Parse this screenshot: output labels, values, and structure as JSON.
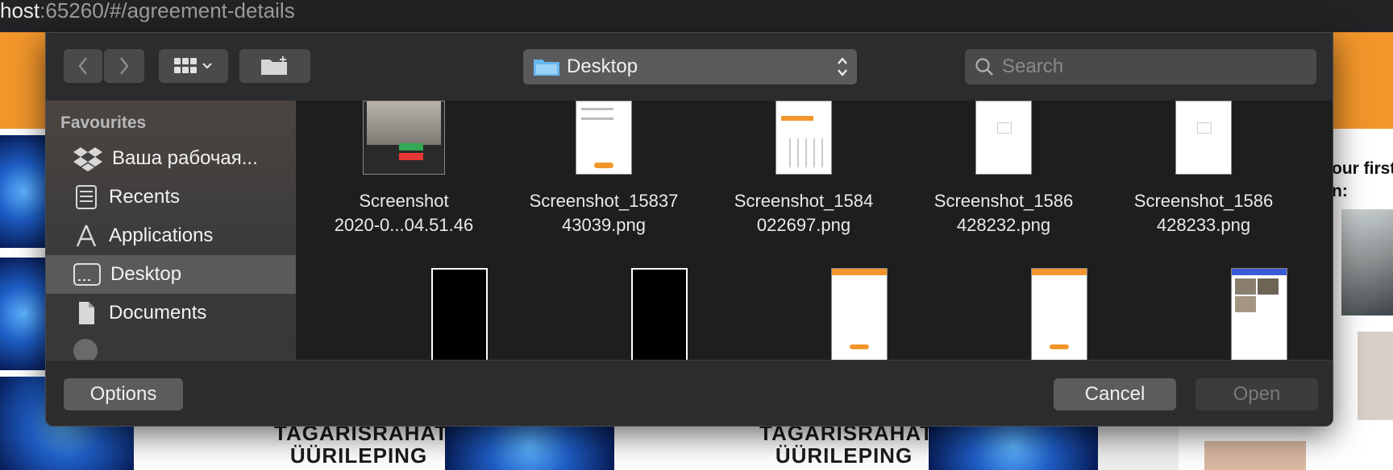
{
  "browser": {
    "url_host": "host",
    "url_rest": ":65260/#/agreement-details"
  },
  "background": {
    "meme_line1": "TAGARISRAHATA",
    "meme_line2": "ÜÜRILEPING",
    "right_text": "our first\nn:"
  },
  "dialog": {
    "location": "Desktop",
    "search_placeholder": "Search",
    "sidebar": {
      "heading": "Favourites",
      "items": [
        {
          "label": "Ваша рабочая...",
          "icon": "dropbox-icon"
        },
        {
          "label": "Recents",
          "icon": "recents-icon"
        },
        {
          "label": "Applications",
          "icon": "applications-icon"
        },
        {
          "label": "Desktop",
          "icon": "desktop-icon",
          "selected": true
        },
        {
          "label": "Documents",
          "icon": "documents-icon"
        }
      ]
    },
    "files": [
      {
        "line1": "Screenshot",
        "line2": "2020-0...04.51.46"
      },
      {
        "line1": "Screenshot_15837",
        "line2": "43039.png"
      },
      {
        "line1": "Screenshot_1584",
        "line2": "022697.png"
      },
      {
        "line1": "Screenshot_1586",
        "line2": "428232.png"
      },
      {
        "line1": "Screenshot_1586",
        "line2": "428233.png"
      }
    ],
    "buttons": {
      "options": "Options",
      "cancel": "Cancel",
      "open": "Open"
    }
  }
}
